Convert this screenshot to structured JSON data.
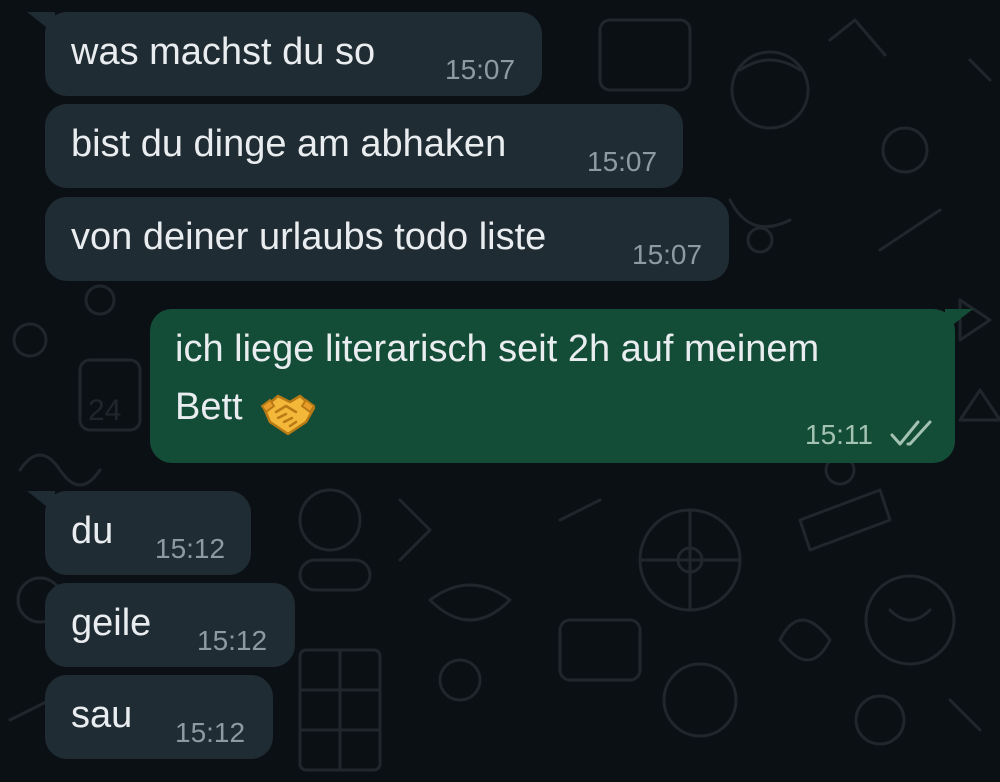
{
  "conversation": {
    "messages": [
      {
        "direction": "incoming",
        "text": "was machst du so",
        "time": "15:07"
      },
      {
        "direction": "incoming",
        "text": "bist du dinge am abhaken",
        "time": "15:07"
      },
      {
        "direction": "incoming",
        "text": "von deiner urlaubs todo liste",
        "time": "15:07"
      },
      {
        "direction": "outgoing",
        "text_line1": "ich liege literarisch seit 2h auf meinem",
        "text_line2": "Bett",
        "emoji": "handshake-emoji",
        "time": "15:11",
        "status": "read-double-check"
      },
      {
        "direction": "incoming",
        "text": "du",
        "time": "15:12"
      },
      {
        "direction": "incoming",
        "text": "geile",
        "time": "15:12"
      },
      {
        "direction": "incoming",
        "text": "sau",
        "time": "15:12"
      }
    ]
  },
  "colors": {
    "background": "#0b1014",
    "incoming_bubble": "#202c33",
    "outgoing_bubble": "#134d37",
    "text": "#e9edef",
    "timestamp": "#8d9aa2"
  }
}
